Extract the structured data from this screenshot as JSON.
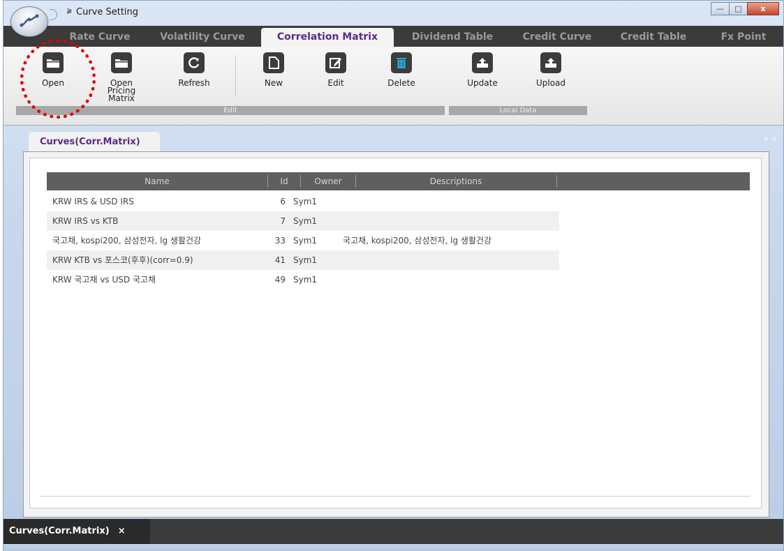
{
  "window": {
    "title": "Curve Setting",
    "qat_symbol": "⫺"
  },
  "window_controls": {
    "minimize": "—",
    "maximize": "□",
    "close": "x"
  },
  "tabs": [
    {
      "label": "Rate Curve"
    },
    {
      "label": "Volatility Curve"
    },
    {
      "label": "Correlation Matrix"
    },
    {
      "label": "Dividend Table"
    },
    {
      "label": "Credit Curve"
    },
    {
      "label": "Credit Table"
    },
    {
      "label": "Fx Point"
    }
  ],
  "active_tab": "Correlation Matrix",
  "ribbon": {
    "buttons": {
      "open": "Open",
      "open_pricing_matrix": "Open Pricing Matrix",
      "refresh": "Refresh",
      "new": "New",
      "edit": "Edit",
      "delete": "Delete",
      "update": "Update",
      "upload": "Upload"
    },
    "groups": {
      "edit": "Edit",
      "local_data": "Local Data"
    }
  },
  "document": {
    "tab_label": "Curves(Corr.Matrix)",
    "pin_glyph": "▾ ✕",
    "columns": {
      "name": "Name",
      "id": "Id",
      "owner": "Owner",
      "descriptions": "Descriptions"
    },
    "rows": [
      {
        "name": "KRW IRS & USD IRS",
        "id": "6",
        "owner": "Sym1",
        "descriptions": ""
      },
      {
        "name": "KRW IRS vs KTB",
        "id": "7",
        "owner": "Sym1",
        "descriptions": ""
      },
      {
        "name": "국고채, kospi200, 삼성전자, lg 생활건강",
        "id": "33",
        "owner": "Sym1",
        "descriptions": "국고채, kospi200, 삼성전자, lg 생활건강"
      },
      {
        "name": "KRW KTB vs 포스코(후후)(corr=0.9)",
        "id": "41",
        "owner": "Sym1",
        "descriptions": ""
      },
      {
        "name": "KRW 국고채 vs USD 국고채",
        "id": "49",
        "owner": "Sym1",
        "descriptions": ""
      }
    ]
  },
  "bottom_tab": {
    "label": "Curves(Corr.Matrix)",
    "close": "×"
  },
  "colors": {
    "accent": "#5b2a86",
    "tab_strip": "#3b3b3b",
    "annotation": "#e00000"
  }
}
